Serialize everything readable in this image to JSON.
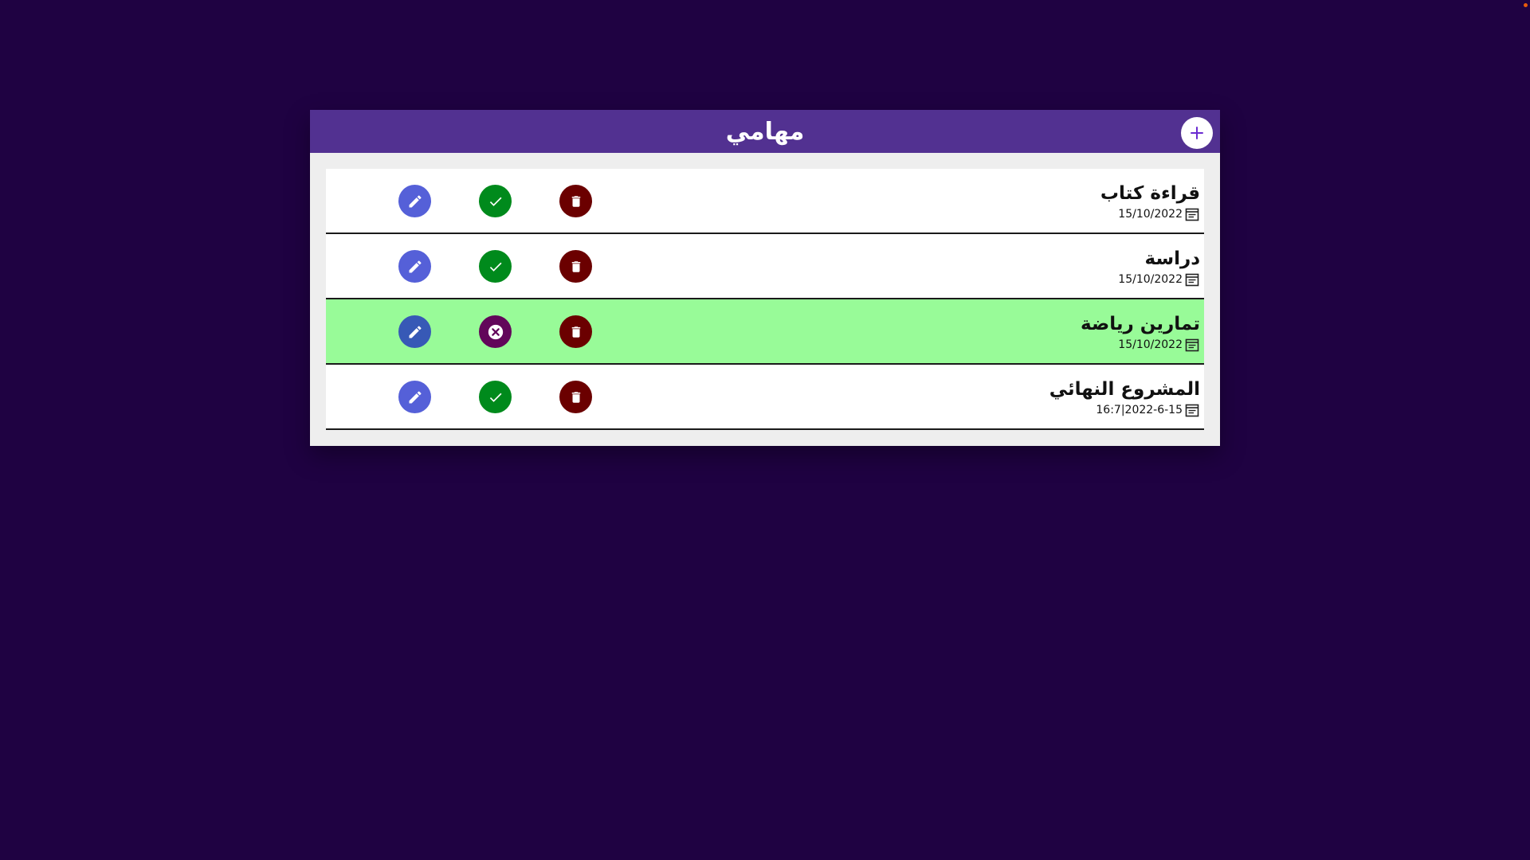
{
  "header": {
    "title": "مهامي",
    "add_label": "+"
  },
  "tasks": [
    {
      "title": "قراءة كتاب",
      "date": "15/10/2022",
      "completed": false
    },
    {
      "title": "دراسة",
      "date": "15/10/2022",
      "completed": false
    },
    {
      "title": "تمارين رياضة",
      "date": "15/10/2022",
      "completed": true
    },
    {
      "title": "المشروع النهائي",
      "date": "16:7|2022-6-15",
      "completed": false
    }
  ],
  "colors": {
    "background": "#1f0242",
    "header": "#523191",
    "completed_row": "#98fb98",
    "edit": "#5560d8",
    "done": "#008a1c",
    "undo": "#62065a",
    "delete": "#6b0000",
    "status_dot": "#e85a0c"
  },
  "icons": {
    "add": "plus-icon",
    "edit": "pencil-icon",
    "done": "check-icon",
    "undo": "close-circle-icon",
    "delete": "trash-icon",
    "date": "calendar-icon"
  }
}
